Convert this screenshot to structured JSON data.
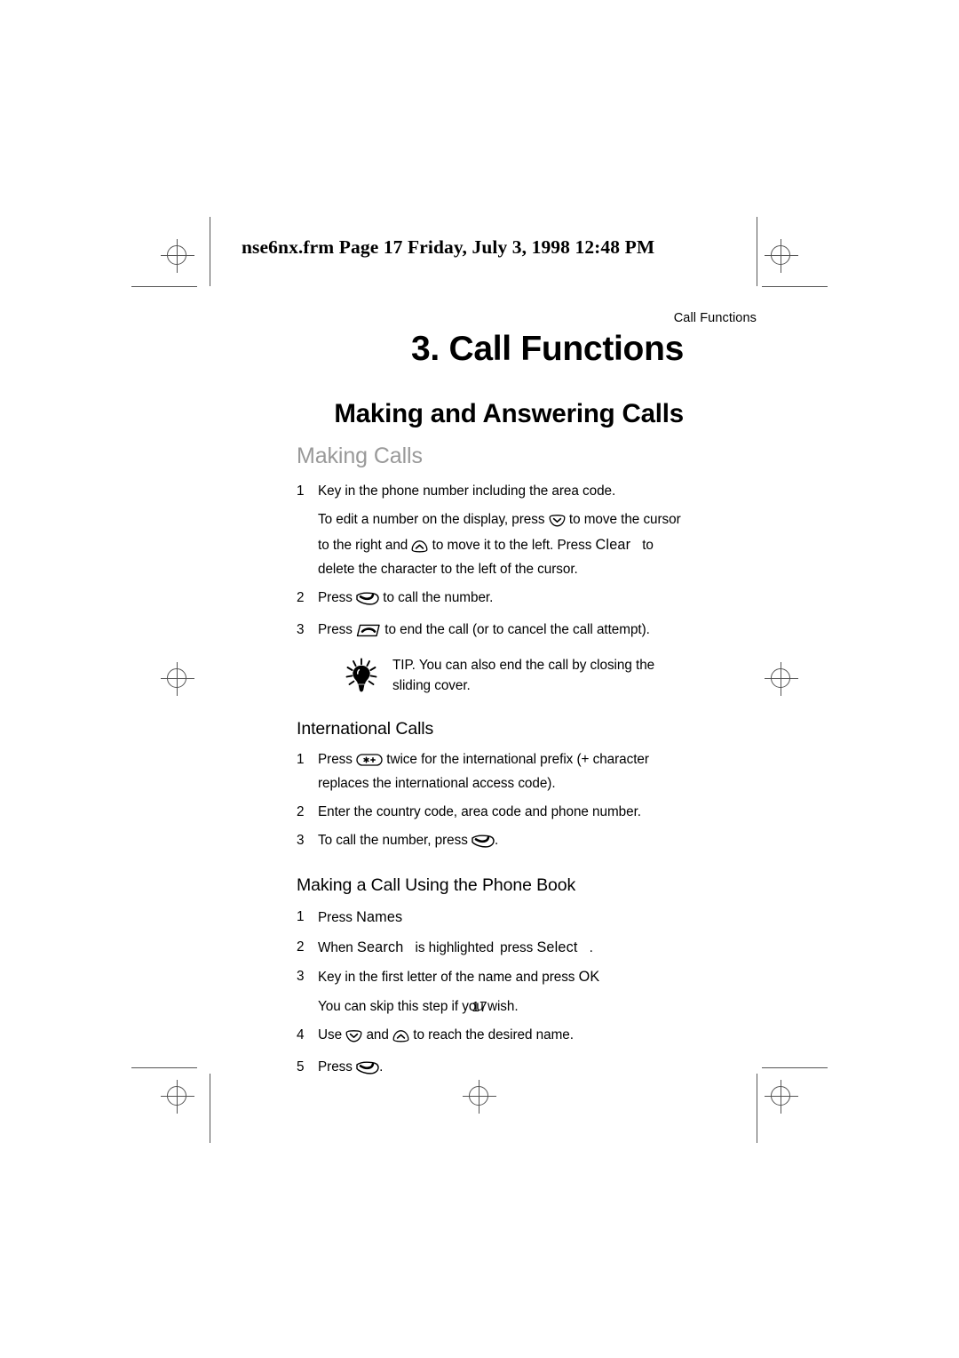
{
  "page": {
    "framemaker_banner": "nse6nx.frm  Page 17  Friday, July 3, 1998  12:48 PM",
    "running_header": "Call Functions",
    "folio": "17"
  },
  "headings": {
    "chapter": "3. Call Functions",
    "section": "Making and Answering Calls",
    "subsection": "Making Calls",
    "international": "International Calls",
    "phonebook": "Making a Call Using the Phone Book"
  },
  "making_calls": {
    "step1_num": "1",
    "step1_text": "Key in the phone number including the area code.",
    "step1_para_a": "To edit a number on the display, press",
    "step1_para_b": "to move the cursor to the right and",
    "step1_para_c": "to move it to the left. Press",
    "step1_softkey": "Clear",
    "step1_para_d": "to delete the character to the left of the cursor.",
    "step2_num": "2",
    "step2_a": "Press",
    "step2_b": "to call the number.",
    "step3_num": "3",
    "step3_a": "Press",
    "step3_b": "to end the call (or to cancel the call attempt).",
    "tip_label": "TIP.",
    "tip_text": "You can also end the call by closing the sliding cover."
  },
  "international_calls": {
    "step1_num": "1",
    "step1_a": "Press",
    "step1_b": "twice for the international prefix (+ character replaces the international access code).",
    "step2_num": "2",
    "step2_text": "Enter the country code, area code and phone number.",
    "step3_num": "3",
    "step3_a": "To call the number, press",
    "step3_b": "."
  },
  "phone_book": {
    "step1_num": "1",
    "step1_a": "Press",
    "step1_softkey": "Names",
    "step2_num": "2",
    "step2_a": "When",
    "step2_softkey_1": "Search",
    "step2_b": "is highlighted",
    "step2_c": "press",
    "step2_softkey_2": "Select",
    "step2_d": ".",
    "step3_num": "3",
    "step3_a": "Key in the first letter of the name and press",
    "step3_softkey": "OK",
    "step3_note": "You can skip this step if you wish.",
    "step4_num": "4",
    "step4_a": "Use",
    "step4_b": "and",
    "step4_c": "to reach the desired name.",
    "step5_num": "5",
    "step5_a": "Press",
    "step5_b": "."
  },
  "icons": {
    "scroll_down": "scroll-down-key-icon",
    "scroll_up": "scroll-up-key-icon",
    "send_key": "send-key-icon",
    "end_key": "end-key-icon",
    "star_key": "star-key-icon",
    "tip_bulb": "lightbulb-icon",
    "registration": "registration-mark-icon"
  },
  "colors": {
    "text": "#000000",
    "subsection_gray": "#999999",
    "mark_gray": "#555555",
    "page_background": "#ffffff"
  }
}
